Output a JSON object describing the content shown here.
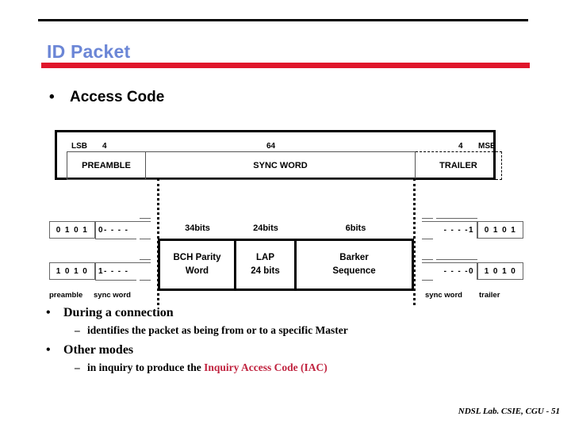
{
  "slide": {
    "title": "ID Packet",
    "title_color": "#6b86d6",
    "accent_color": "#e0152b",
    "rule_color": "#000000"
  },
  "top_bullet": {
    "marker": "•",
    "text": "Access Code"
  },
  "diagram": {
    "top_packet": {
      "bit_labels": {
        "lsb": "LSB",
        "preamble_bits": "4",
        "sync_bits": "64",
        "trailer_bits": "4",
        "msb": "MSB"
      },
      "fields": [
        {
          "label": "PREAMBLE",
          "style": "solid"
        },
        {
          "label": "SYNC WORD",
          "style": "solid"
        },
        {
          "label": "TRAILER",
          "style": "dashed"
        }
      ]
    },
    "bit_counts": [
      "34bits",
      "24bits",
      "6bits"
    ],
    "lower_packet": {
      "cells": [
        {
          "line1": "BCH Parity",
          "line2": "Word"
        },
        {
          "line1": "LAP",
          "line2": "24 bits"
        },
        {
          "line1": "Barker",
          "line2": "Sequence"
        }
      ]
    },
    "left_group": {
      "rows": [
        {
          "solid": "0 1 0 1",
          "open": "0- - - -"
        },
        {
          "solid": "1 0 1 0",
          "open": "1- - - -"
        }
      ],
      "labels": {
        "a": "preamble",
        "b": "sync word"
      }
    },
    "right_group": {
      "rows": [
        {
          "open": "- - - -1",
          "solid": "0 1 0 1"
        },
        {
          "open": "- - - -0",
          "solid": "1 0 1 0"
        }
      ],
      "labels": {
        "a": "sync word",
        "b": "trailer"
      }
    }
  },
  "body": {
    "bullets": [
      {
        "marker": "•",
        "text": "During a connection",
        "sub_marker": "–",
        "sub_text": "identifies the packet as being from or to a specific Master",
        "sub_highlight": ""
      },
      {
        "marker": "•",
        "text": "Other modes",
        "sub_marker": "–",
        "sub_text": "in inquiry to produce the ",
        "sub_highlight": "Inquiry Access Code (IAC)"
      }
    ]
  },
  "footer": {
    "text": "NDSL Lab. CSIE, CGU - 51"
  }
}
